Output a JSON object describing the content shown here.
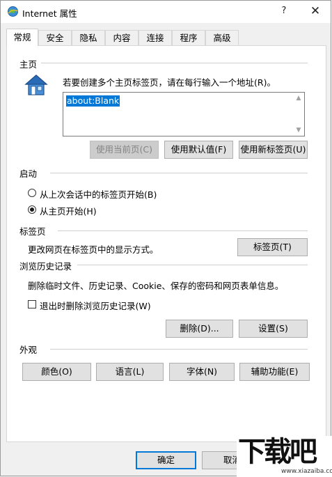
{
  "window": {
    "title": "Internet 属性",
    "help": "?",
    "close": "✕"
  },
  "tabs": [
    {
      "label": "常规",
      "active": true
    },
    {
      "label": "安全"
    },
    {
      "label": "隐私"
    },
    {
      "label": "内容"
    },
    {
      "label": "连接"
    },
    {
      "label": "程序"
    },
    {
      "label": "高级"
    }
  ],
  "home": {
    "section": "主页",
    "description": "若要创建多个主页标签页，请在每行输入一个地址(R)。",
    "value": "about:Blank",
    "buttons": {
      "use_current": "使用当前页(C)",
      "use_default": "使用默认值(F)",
      "use_new_tab": "使用新标签页(U)"
    }
  },
  "startup": {
    "section": "启动",
    "option_last_session": "从上次会话中的标签页开始(B)",
    "option_home": "从主页开始(H)",
    "selected": "option_home"
  },
  "tabs_section": {
    "section": "标签页",
    "description": "更改网页在标签页中的显示方式。",
    "button": "标签页(T)"
  },
  "history": {
    "section": "浏览历史记录",
    "description": "删除临时文件、历史记录、Cookie、保存的密码和网页表单信息。",
    "checkbox": "退出时删除浏览历史记录(W)",
    "checked": false,
    "delete_button": "删除(D)...",
    "settings_button": "设置(S)"
  },
  "appearance": {
    "section": "外观",
    "colors": "颜色(O)",
    "languages": "语言(L)",
    "fonts": "字体(N)",
    "accessibility": "辅助功能(E)"
  },
  "footer": {
    "ok": "确定",
    "cancel": "取消"
  },
  "watermark": {
    "main": "下载吧",
    "sub": "www.xiazaiba.com"
  },
  "colors": {
    "accent": "#0078d7",
    "panel": "#ffffff",
    "chrome": "#f0f0f0"
  }
}
